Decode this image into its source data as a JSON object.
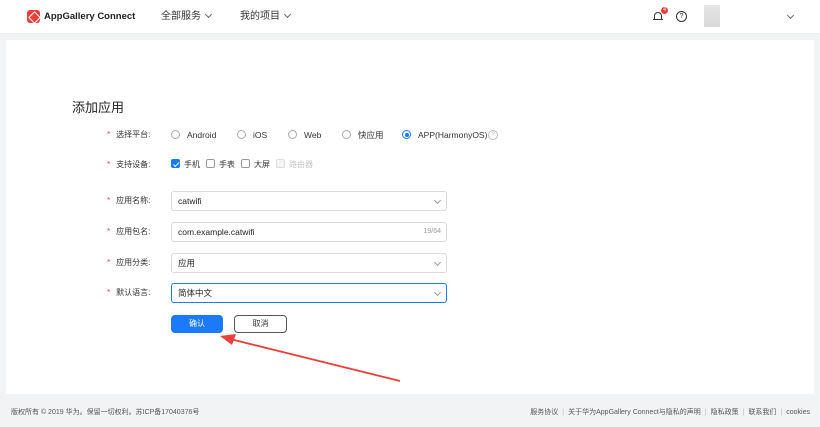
{
  "header": {
    "brand": "AppGallery Connect",
    "nav": [
      {
        "label": "全部服务"
      },
      {
        "label": "我的项目"
      }
    ],
    "notification_count": "4",
    "help_symbol": "?"
  },
  "form": {
    "title": "添加应用",
    "platform": {
      "label": "选择平台:",
      "options": [
        "Android",
        "iOS",
        "Web",
        "快应用",
        "APP(HarmonyOS)"
      ],
      "selected": "APP(HarmonyOS)",
      "help_symbol": "?"
    },
    "devices": {
      "label": "支持设备:",
      "options": [
        {
          "label": "手机",
          "checked": true,
          "disabled": false
        },
        {
          "label": "手表",
          "checked": false,
          "disabled": false
        },
        {
          "label": "大屏",
          "checked": false,
          "disabled": false
        },
        {
          "label": "路由器",
          "checked": false,
          "disabled": true
        }
      ]
    },
    "app_name": {
      "label": "应用名称:",
      "value": "catwifi"
    },
    "package_name": {
      "label": "应用包名:",
      "value": "com.example.catwifi",
      "counter": "19/64"
    },
    "category": {
      "label": "应用分类:",
      "value": "应用"
    },
    "default_language": {
      "label": "默认语言:",
      "value": "简体中文"
    },
    "confirm_label": "确认",
    "cancel_label": "取消"
  },
  "footer": {
    "copyright": "版权所有 © 2019 华为。保留一切权利。苏ICP备17040376号",
    "links": [
      "服务协议",
      "关于华为AppGallery Connect与隐私的声明",
      "隐私政策",
      "联系我们",
      "cookies"
    ]
  },
  "colors": {
    "primary": "#1b7af7",
    "brand_red": "#e8413c",
    "annotation_arrow": "#e8413c"
  }
}
